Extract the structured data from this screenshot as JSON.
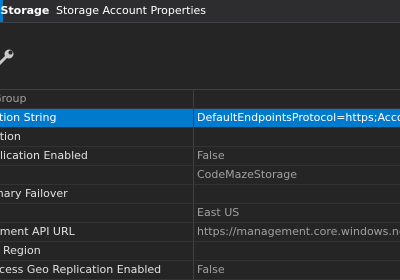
{
  "titlebar": {
    "object_name": "eStorage",
    "window_title": "Storage Account Properties",
    "accent_color": "#007acc"
  },
  "toolbar": {
    "icon": "wrench-icon"
  },
  "properties": [
    {
      "name": "Group",
      "value": "",
      "type": "category"
    },
    {
      "name": "ction String",
      "value": "DefaultEndpointsProtocol=https;Accou",
      "selected": true
    },
    {
      "name": "ation",
      "value": ""
    },
    {
      "name": "plication Enabled",
      "value": "False"
    },
    {
      "name": "",
      "value": "CodeMazeStorage"
    },
    {
      "name": "mary Failover",
      "value": ""
    },
    {
      "name": "n",
      "value": "East US"
    },
    {
      "name": "ement API URL",
      "value": "https://management.core.windows.ne"
    },
    {
      "name": "y Region",
      "value": ""
    },
    {
      "name": "ccess Geo Replication Enabled",
      "value": "False"
    }
  ],
  "colors": {
    "background": "#252526",
    "selection": "#007acc"
  }
}
